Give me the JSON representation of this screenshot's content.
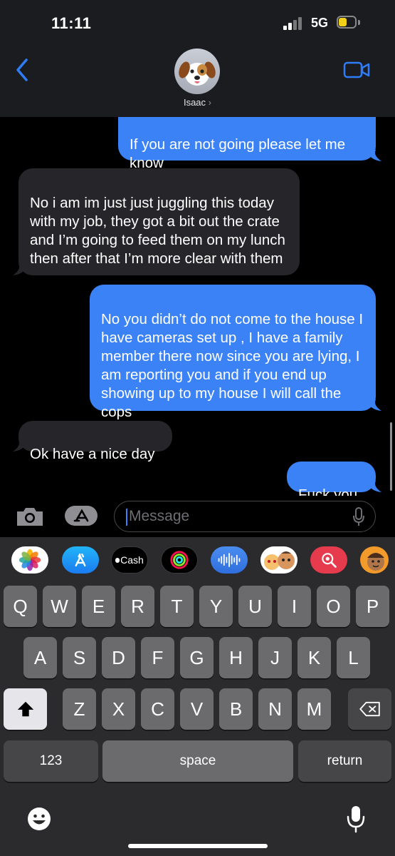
{
  "status": {
    "time": "11:11",
    "network": "5G"
  },
  "header": {
    "contact_name": "Isaac",
    "chevron": "›"
  },
  "messages": [
    {
      "dir": "out",
      "text": "If you are not going please let me know"
    },
    {
      "dir": "in",
      "text": "No i am im just just juggling this today with my job, they got a bit out the crate and I’m going to feed them on my lunch then after that I’m more clear with them"
    },
    {
      "dir": "out",
      "text": "No you didn’t do not come to the house I have cameras set up , I have a family member there now since you are lying, I am reporting you and if you end up showing up to my house I will call the cops"
    },
    {
      "dir": "in",
      "text": "Ok have a nice day"
    },
    {
      "dir": "out",
      "text": "Fuck you"
    }
  ],
  "input": {
    "placeholder": "Message"
  },
  "app_drawer": [
    "photos-icon",
    "app-store-icon",
    "apple-cash-icon",
    "activity-icon",
    "audio-message-icon",
    "memoji-stickers-icon",
    "image-search-icon",
    "memoji-icon"
  ],
  "app_cash_label": "Cash",
  "keyboard": {
    "row1": [
      "Q",
      "W",
      "E",
      "R",
      "T",
      "Y",
      "U",
      "I",
      "O",
      "P"
    ],
    "row2": [
      "A",
      "S",
      "D",
      "F",
      "G",
      "H",
      "J",
      "K",
      "L"
    ],
    "row3": [
      "Z",
      "X",
      "C",
      "V",
      "B",
      "N",
      "M"
    ],
    "numbers": "123",
    "space": "space",
    "return": "return"
  },
  "colors": {
    "outgoing": "#3b82f6",
    "incoming": "#26262a",
    "accent": "#3b82f6"
  }
}
